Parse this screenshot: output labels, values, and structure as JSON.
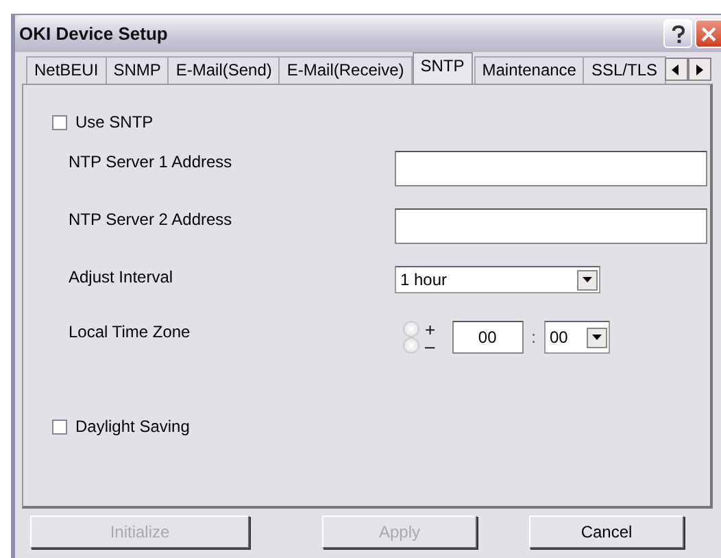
{
  "window": {
    "title": "OKI Device Setup"
  },
  "tabs": [
    {
      "label": "NetBEUI",
      "selected": false
    },
    {
      "label": "SNMP",
      "selected": false
    },
    {
      "label": "E-Mail(Send)",
      "selected": false
    },
    {
      "label": "E-Mail(Receive)",
      "selected": false
    },
    {
      "label": "SNTP",
      "selected": true
    },
    {
      "label": "Maintenance",
      "selected": false
    },
    {
      "label": "SSL/TLS",
      "selected": false
    }
  ],
  "use_sntp": {
    "label": "Use SNTP",
    "checked": false
  },
  "ntp_server_1": {
    "label": "NTP Server 1 Address"
  },
  "ntp_server_2": {
    "label": "NTP Server 2 Address"
  },
  "adjust_interval": {
    "label": "Adjust Interval",
    "value": "1 hour"
  },
  "local_time_zone": {
    "label": "Local Time Zone",
    "signs": [
      {
        "label": "+",
        "selected": false
      },
      {
        "label": "–",
        "selected": false
      }
    ],
    "hours": "00",
    "separator": ":",
    "minutes": "00"
  },
  "daylight_saving": {
    "label": "Daylight Saving",
    "checked": false
  },
  "buttons": [
    {
      "label": "Initialize",
      "disabled": true
    },
    {
      "label": "Apply",
      "disabled": true
    },
    {
      "label": "Cancel",
      "disabled": false
    }
  ]
}
